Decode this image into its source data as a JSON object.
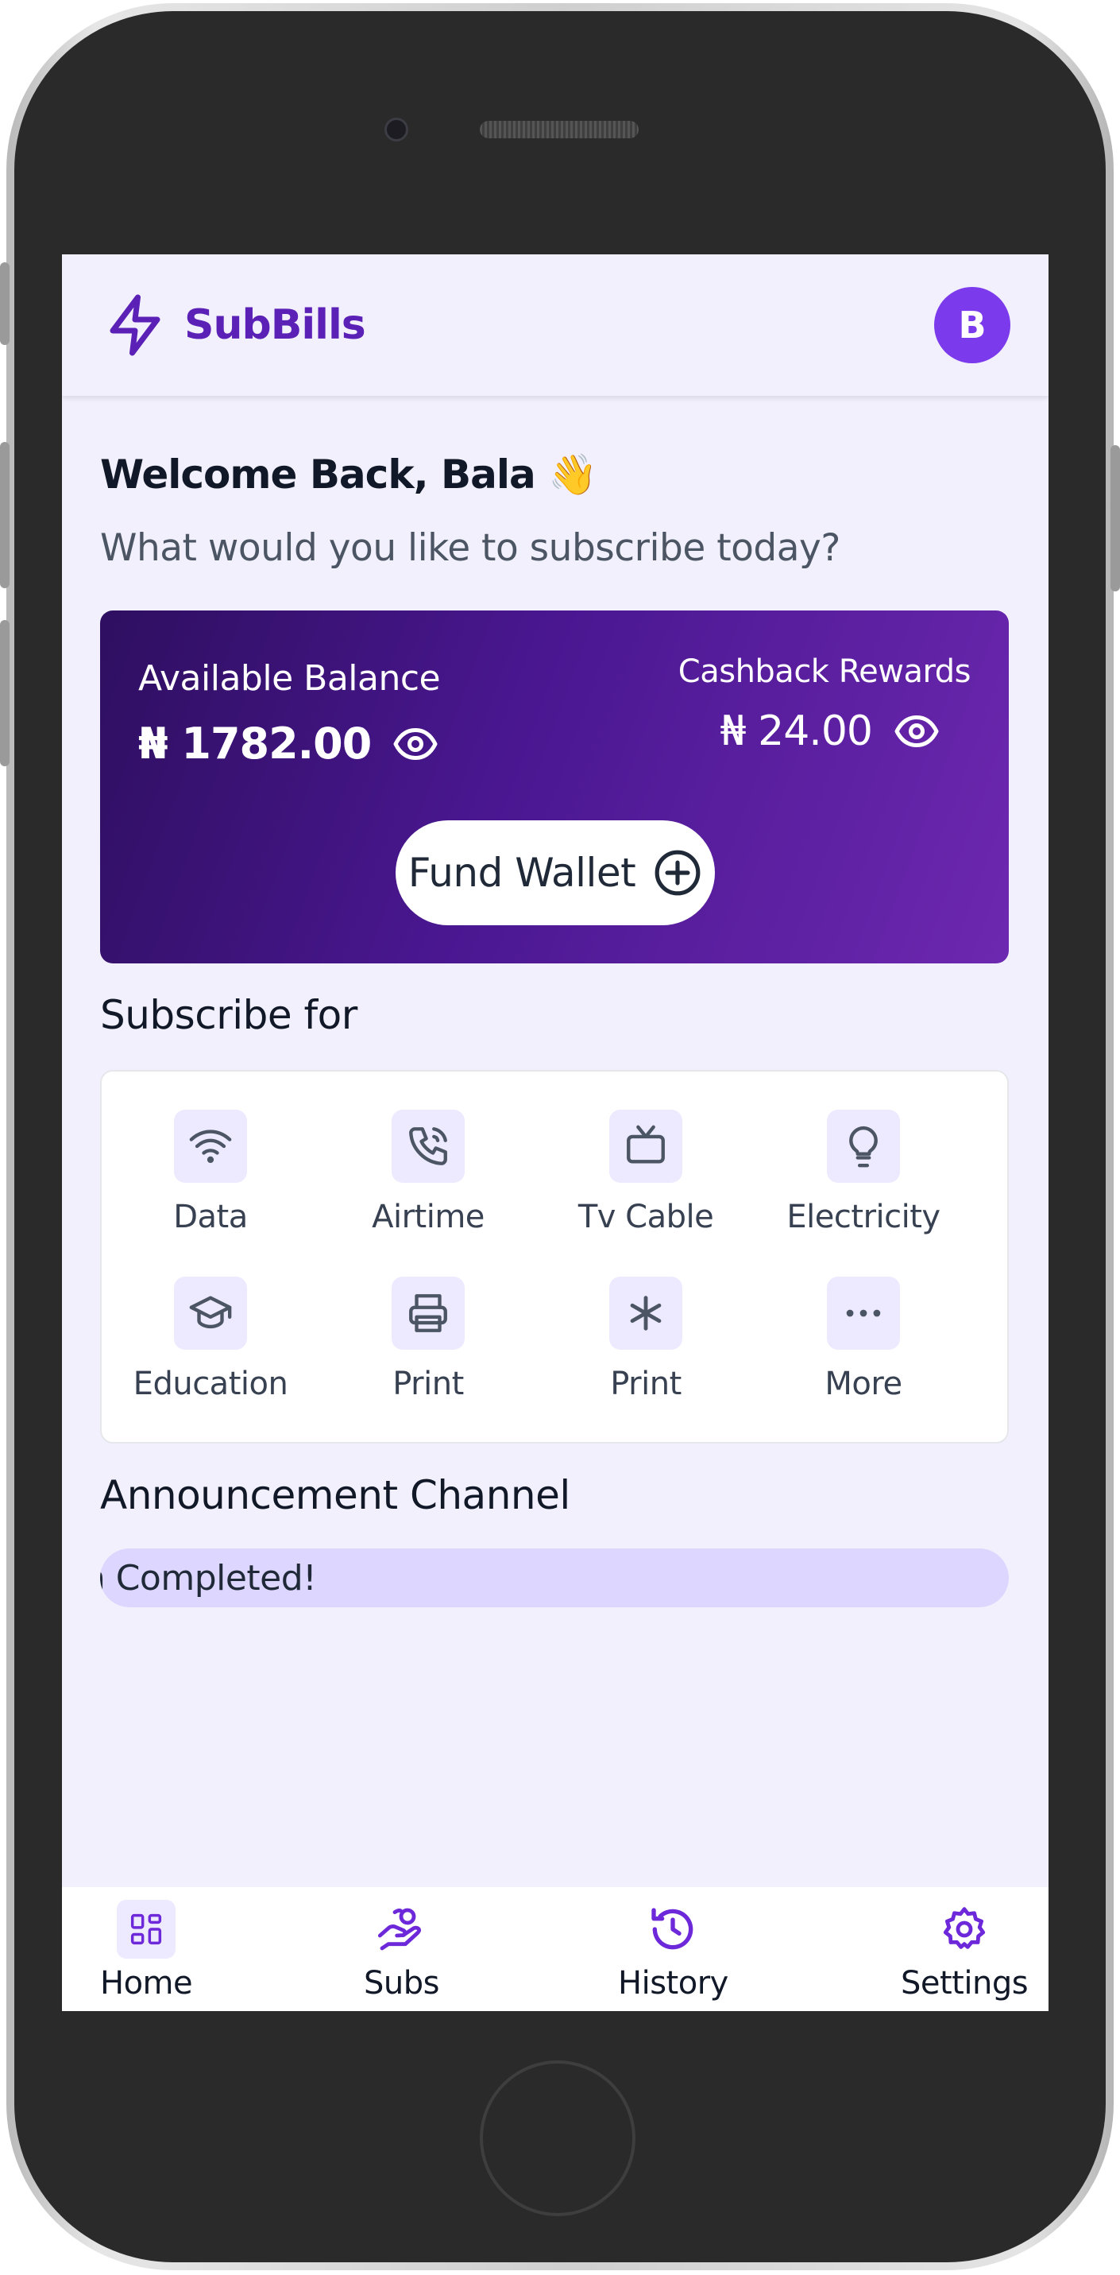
{
  "header": {
    "brand": "SubBills",
    "avatar_initial": "B",
    "logo_icon": "lightning-bolt-icon"
  },
  "greeting": {
    "welcome": "Welcome Back, Bala 👋",
    "subtitle": "What would you like to subscribe today?"
  },
  "wallet": {
    "balance_label": "Available Balance",
    "balance_value": "₦ 1782.00",
    "cashback_label": "Cashback Rewards",
    "cashback_value": "₦ 24.00",
    "fund_button": "Fund Wallet",
    "gradient": [
      "#2e0f60",
      "#6d28b0"
    ]
  },
  "services": {
    "title": "Subscribe for",
    "items": [
      {
        "label": "Data",
        "icon": "wifi-icon"
      },
      {
        "label": "Airtime",
        "icon": "phone-call-icon"
      },
      {
        "label": "Tv Cable",
        "icon": "tv-icon"
      },
      {
        "label": "Electricity",
        "icon": "lightbulb-icon"
      },
      {
        "label": "Education",
        "icon": "graduation-cap-icon"
      },
      {
        "label": "Print",
        "icon": "printer-icon"
      },
      {
        "label": "Print",
        "icon": "asterisk-icon"
      },
      {
        "label": "More",
        "icon": "ellipsis-icon"
      }
    ]
  },
  "announcement": {
    "title": "Announcement Channel",
    "message": "Transaction Completed!"
  },
  "nav": {
    "items": [
      {
        "label": "Home",
        "icon": "grid-icon",
        "active": true
      },
      {
        "label": "Subs",
        "icon": "hand-coins-icon"
      },
      {
        "label": "History",
        "icon": "history-icon"
      },
      {
        "label": "Settings",
        "icon": "gear-icon"
      }
    ]
  },
  "colors": {
    "accent": "#7c3aed",
    "brand_text": "#5b21b6",
    "screen_bg": "#f2f0fd",
    "icon_tile_bg": "#ede9fe",
    "marquee_bg": "#ddd6fe"
  }
}
